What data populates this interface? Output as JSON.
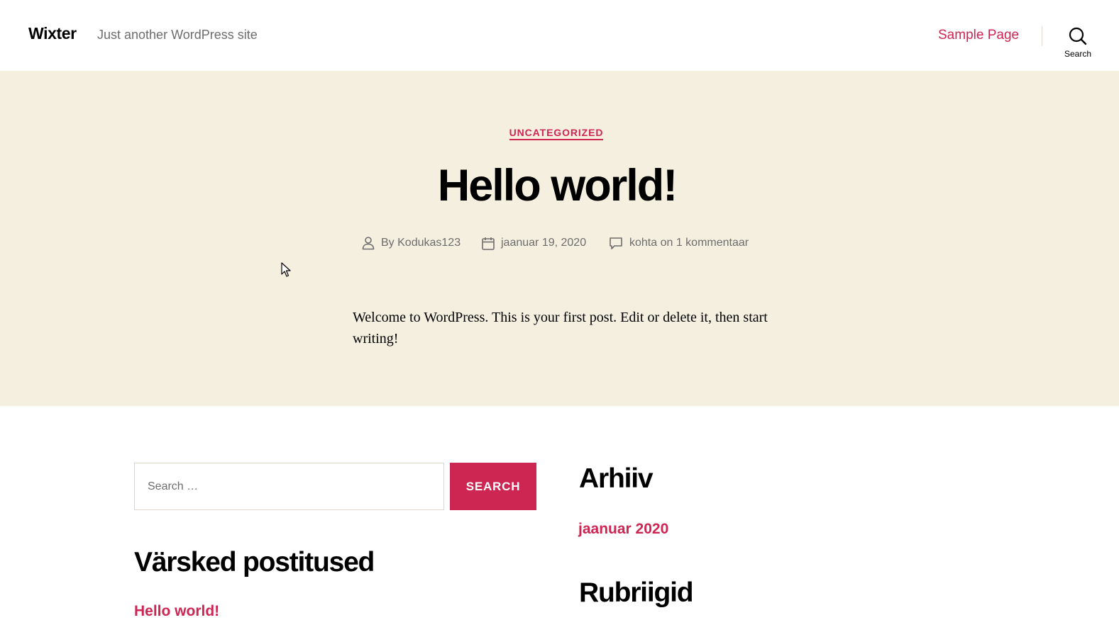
{
  "header": {
    "site_title": "Wixter",
    "site_description": "Just another WordPress site",
    "nav": [
      {
        "label": "Sample Page"
      }
    ],
    "search_label": "Search"
  },
  "post": {
    "category": "UNCATEGORIZED",
    "title": "Hello world!",
    "meta": {
      "author": "Kodukas123",
      "author_prefix": "By",
      "date": "jaanuar 19, 2020",
      "comments": "kohta on 1 kommentaar"
    },
    "content": "Welcome to WordPress. This is your first post. Edit or delete it, then start writing!"
  },
  "widgets": {
    "search": {
      "placeholder": "Search …",
      "button_label": "SEARCH"
    },
    "recent_posts": {
      "heading": "Värsked postitused",
      "items": [
        {
          "label": "Hello world!"
        }
      ]
    },
    "archive": {
      "heading": "Arhiiv",
      "items": [
        {
          "label": "jaanuar 2020"
        }
      ]
    },
    "categories": {
      "heading": "Rubriigid"
    }
  },
  "colors": {
    "accent": "#cd2653",
    "hero_background": "#f5efe0",
    "secondary_text": "#6d6d6d"
  },
  "icons": [
    "search-icon",
    "user-icon",
    "calendar-icon",
    "comment-icon",
    "mouse-cursor-icon"
  ]
}
